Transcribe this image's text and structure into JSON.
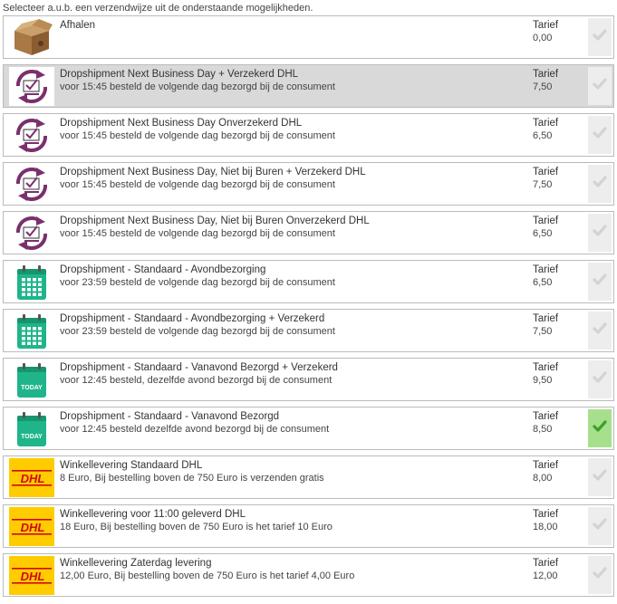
{
  "intro": "Selecteer a.u.b. een verzendwijze uit de onderstaande mogelijkheden.",
  "tarief_label": "Tarief",
  "colors": {
    "check_inactive": "#d3d3d3",
    "check_active": "#3aa02a",
    "check_bg_active": "#a7e08d",
    "highlight_row": "#d9d9d9",
    "purple": "#7b2f6d",
    "calendar_green": "#1fb58a",
    "dhl_yellow": "#ffcc00",
    "dhl_red": "#d40511"
  },
  "options": [
    {
      "title": "Afhalen",
      "desc": "",
      "price": "0,00",
      "icon": "box-icon"
    },
    {
      "title": "Dropshipment Next Business Day + Verzekerd DHL",
      "desc": "voor 15:45 besteld de volgende dag bezorgd bij de consument",
      "price": "7,50",
      "icon": "next-day-icon"
    },
    {
      "title": "Dropshipment Next Business Day Onverzekerd DHL",
      "desc": "voor 15:45 besteld de volgende dag bezorgd bij de consument",
      "price": "6,50",
      "icon": "next-day-icon"
    },
    {
      "title": "Dropshipment Next Business Day, Niet bij Buren + Verzekerd DHL",
      "desc": "voor 15:45 besteld de volgende dag bezorgd bij de consument",
      "price": "7,50",
      "icon": "next-day-icon"
    },
    {
      "title": "Dropshipment Next Business Day, Niet bij Buren Onverzekerd DHL",
      "desc": "voor 15:45 besteld de volgende dag bezorgd bij de consument",
      "price": "6,50",
      "icon": "next-day-icon"
    },
    {
      "title": "Dropshipment - Standaard - Avondbezorging",
      "desc": "voor 23:59 besteld de volgende dag bezorgd bij de consument",
      "price": "6,50",
      "icon": "calendar-icon"
    },
    {
      "title": "Dropshipment - Standaard - Avondbezorging + Verzekerd",
      "desc": "voor 23:59 besteld de volgende dag bezorgd bij de consument",
      "price": "7,50",
      "icon": "calendar-icon"
    },
    {
      "title": "Dropshipment - Standaard - Vanavond Bezorgd + Verzekerd",
      "desc": "voor 12:45 besteld, dezelfde avond bezorgd bij de consument",
      "price": "9,50",
      "icon": "calendar-today-icon",
      "today_label": "TODAY"
    },
    {
      "title": "Dropshipment - Standaard - Vanavond Bezorgd",
      "desc": "voor 12:45 besteld dezelfde avond bezorgd bij de consument",
      "price": "8,50",
      "icon": "calendar-today-icon",
      "today_label": "TODAY",
      "selected": true
    },
    {
      "title": "Winkellevering Standaard DHL",
      "desc": "8 Euro, Bij bestelling boven de 750 Euro is verzenden gratis",
      "price": "8,00",
      "icon": "dhl-logo",
      "logo_text": "DHL"
    },
    {
      "title": "Winkellevering voor 11:00 geleverd DHL",
      "desc": "18 Euro, Bij bestelling boven de 750 Euro is het tarief 10 Euro",
      "price": "18,00",
      "icon": "dhl-logo",
      "logo_text": "DHL"
    },
    {
      "title": "Winkellevering Zaterdag levering",
      "desc": "12,00 Euro, Bij bestelling boven de 750 Euro is het tarief 4,00 Euro",
      "price": "12,00",
      "icon": "dhl-logo",
      "logo_text": "DHL"
    }
  ]
}
